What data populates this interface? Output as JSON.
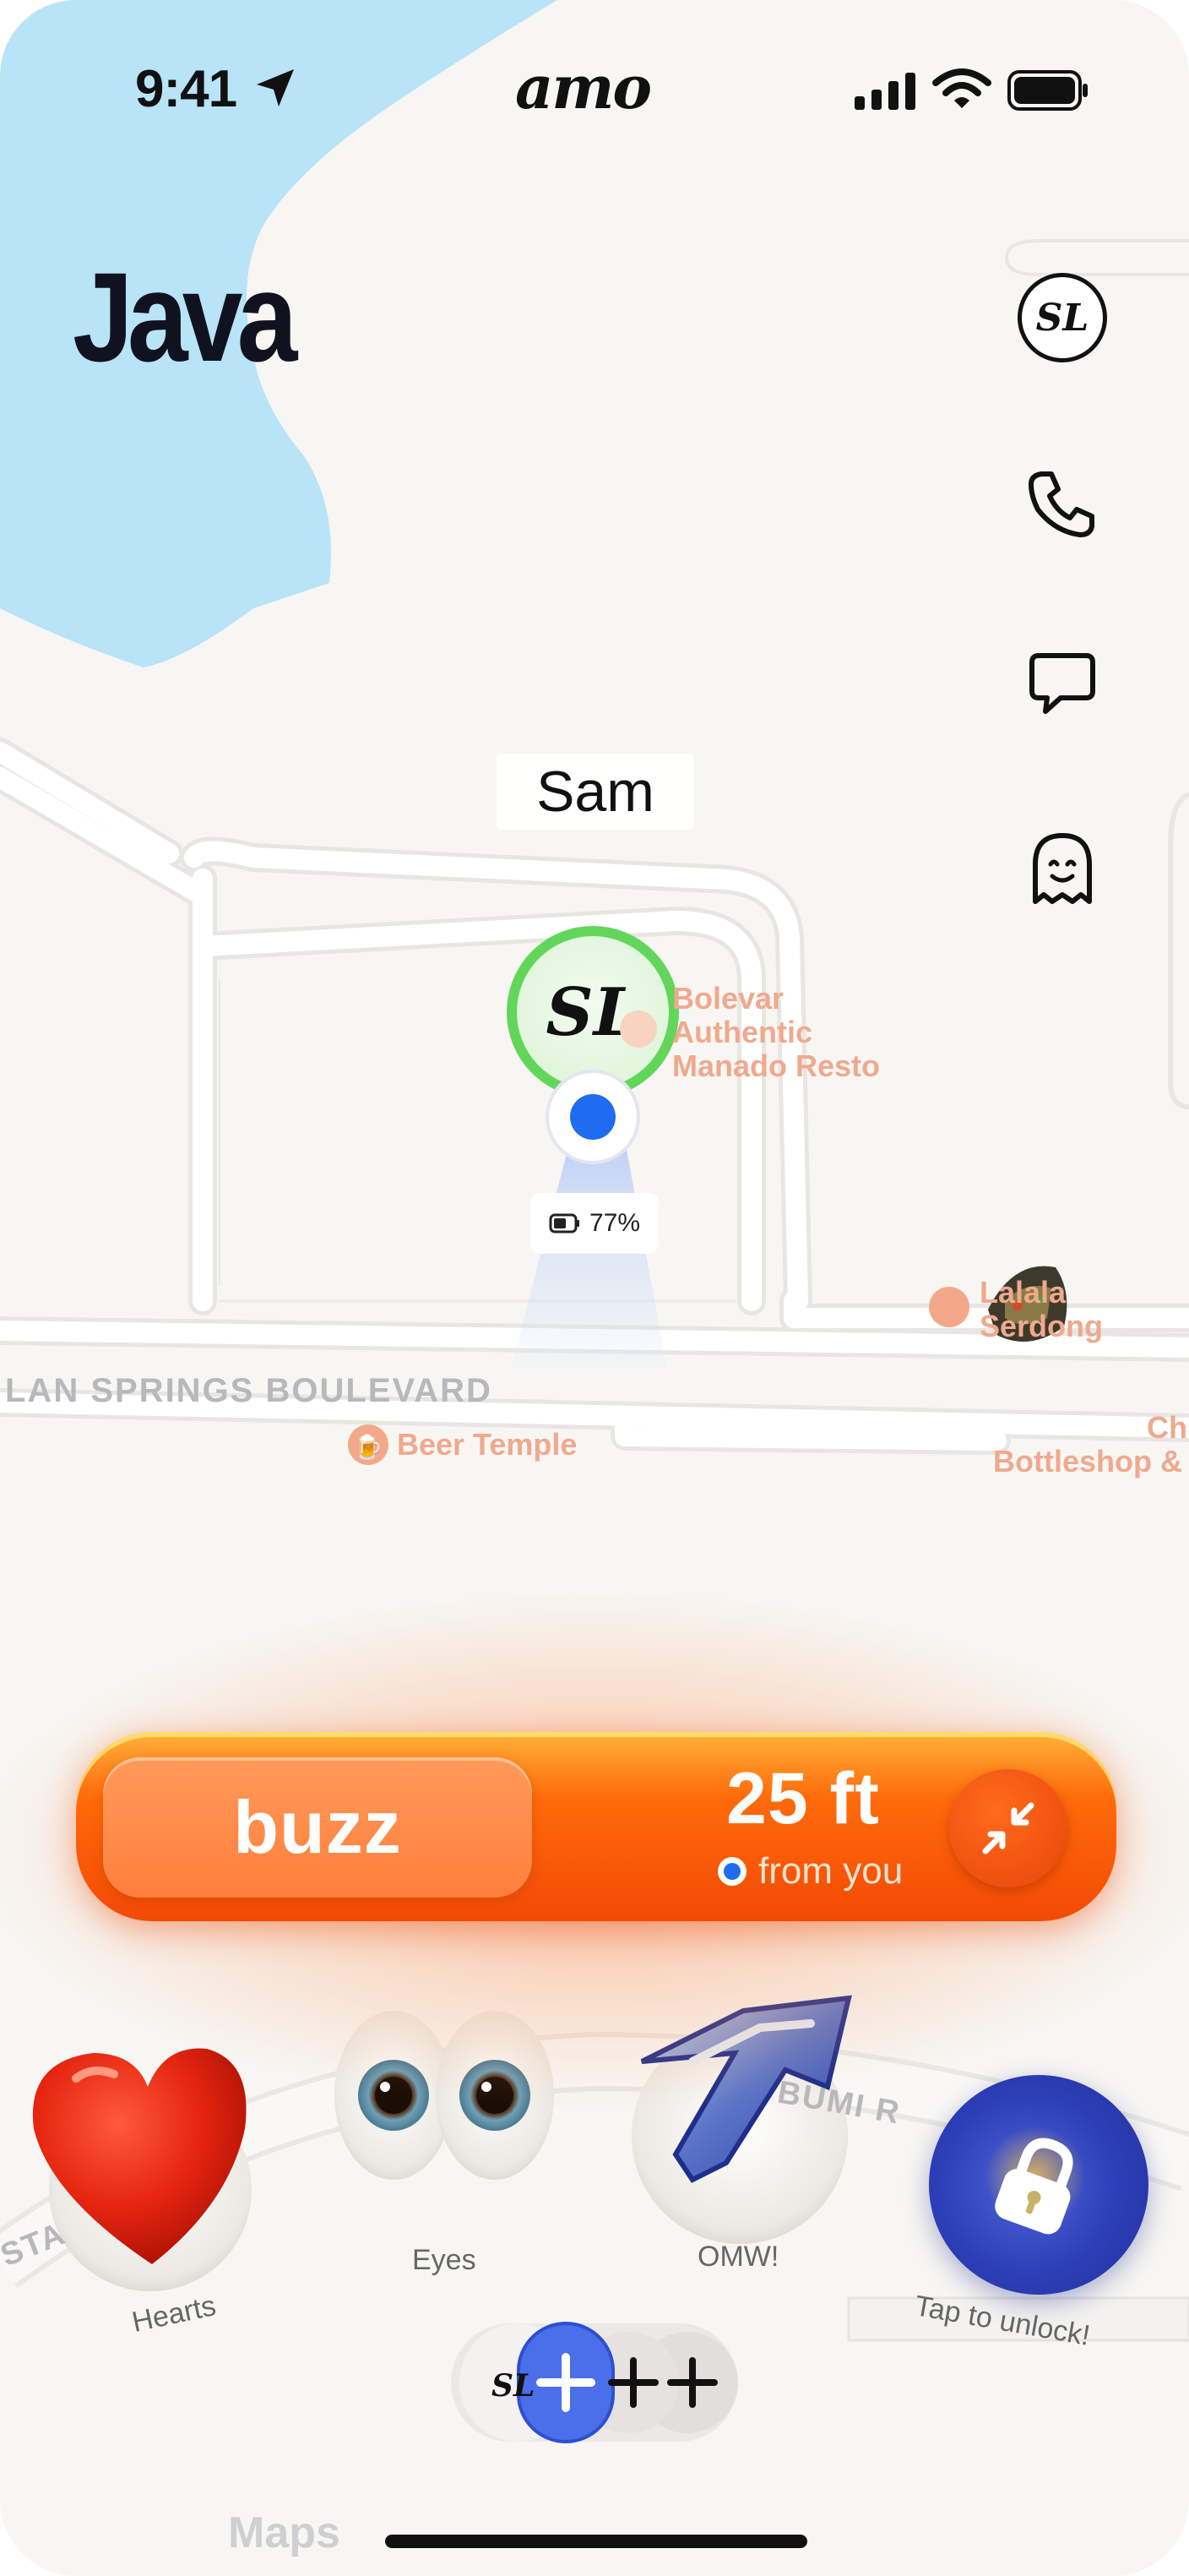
{
  "status_bar": {
    "time": "9:41",
    "app_logo": "amo"
  },
  "map": {
    "place_label": "Java",
    "person_name": "Sam",
    "person_initials": "SL",
    "battery_percent": "77%",
    "road_label": "LAN SPRINGS BOULEVARD",
    "road_label_2": "BUMI R",
    "road_label_3": "STA",
    "pois": {
      "bolevar_line1": "Bolevar",
      "bolevar_line2": "Authentic",
      "bolevar_line3": "Manado Resto",
      "beer_temple": "Beer Temple",
      "lala_line1": "Lalala",
      "lala_line2": "Serdong",
      "chili_line1": "Chill",
      "chili_line2": "Bottleshop & B"
    },
    "attribution": "Maps"
  },
  "actions": {
    "avatar_initials": "SL",
    "icons": [
      "avatar-icon",
      "phone-icon",
      "chat-icon",
      "ghost-icon"
    ]
  },
  "buzz_bar": {
    "button_label": "buzz",
    "distance": "25 ft",
    "distance_caption": "from you"
  },
  "reactions": [
    {
      "label": "Hearts"
    },
    {
      "label": "Eyes"
    },
    {
      "label": "OMW!"
    },
    {
      "label": "Tap to unlock!"
    }
  ],
  "add_strip": {
    "initials": "SL"
  },
  "colors": {
    "accent_orange": "#ff6a0a",
    "location_blue": "#1f6cf0",
    "ring_green": "#62d65a",
    "water": "#b9e3f7",
    "unlock_blue": "#2d3fb8"
  }
}
